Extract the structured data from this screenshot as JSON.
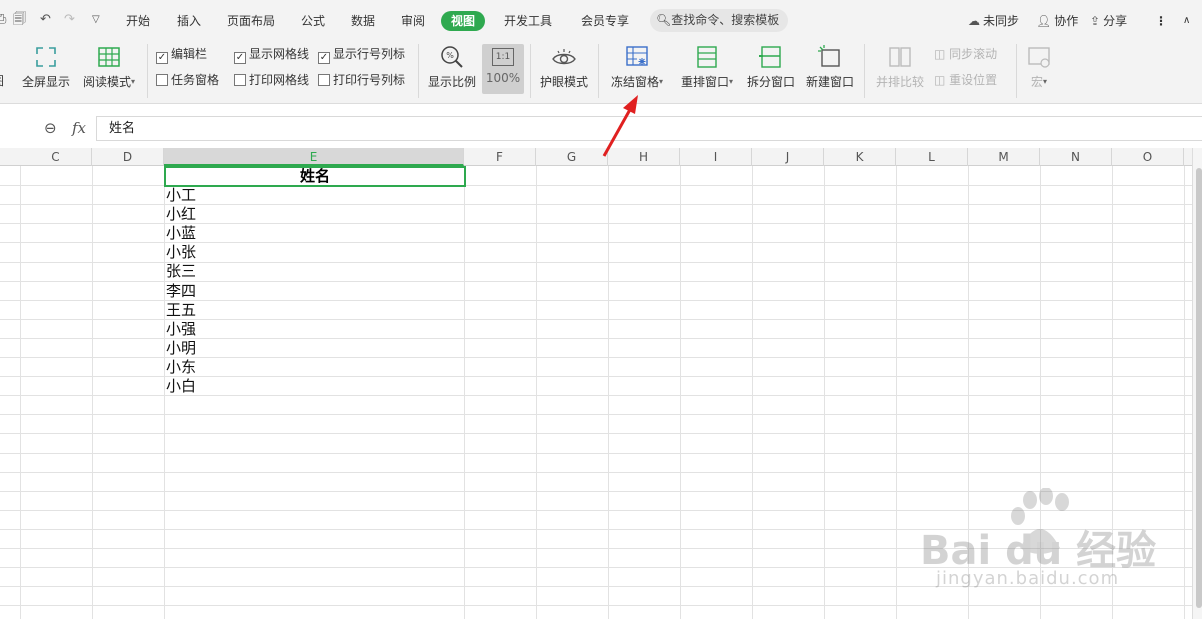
{
  "menu": {
    "start": "开始",
    "insert": "插入",
    "page_layout": "页面布局",
    "formula": "公式",
    "data": "数据",
    "review": "审阅",
    "view": "视图",
    "devtools": "开发工具",
    "member": "会员专享",
    "search_placeholder": "查找命令、搜索模板"
  },
  "top_right": {
    "not_synced": "未同步",
    "collaborate": "协作",
    "share": "分享"
  },
  "ribbon": {
    "partial_left": "图",
    "fullscreen": "全屏显示",
    "reading_mode": "阅读模式",
    "edit_bar": "编辑栏",
    "task_pane": "任务窗格",
    "show_gridlines": "显示网格线",
    "print_gridlines": "打印网格线",
    "show_headers": "显示行号列标",
    "print_headers": "打印行号列标",
    "zoom_ratio": "显示比例",
    "zoom_100": "100%",
    "zoom_1to1": "1:1",
    "eye_mode": "护眼模式",
    "freeze_panes": "冻结窗格",
    "arrange_windows": "重排窗口",
    "split_window": "拆分窗口",
    "new_window": "新建窗口",
    "side_by_side": "并排比较",
    "sync_scroll": "同步滚动",
    "reset_position": "重设位置",
    "macro": "宏"
  },
  "checkbox_state": {
    "edit_bar": true,
    "task_pane": false,
    "show_gridlines": true,
    "print_gridlines": false,
    "show_headers": true,
    "print_headers": false
  },
  "formula_bar": {
    "fx": "fx",
    "content": "姓名"
  },
  "columns": [
    "C",
    "D",
    "E",
    "F",
    "G",
    "H",
    "I",
    "J",
    "K",
    "L",
    "M",
    "N",
    "O"
  ],
  "selected_column": "E",
  "active_cell_value": "姓名",
  "cells": [
    "小工",
    "小红",
    "小蓝",
    "小张",
    "张三",
    "李四",
    "王五",
    "小强",
    "小明",
    "小东",
    "小白"
  ],
  "watermark": {
    "brand": "Bai du 经验",
    "url": "jingyan.baidu.com"
  },
  "colors": {
    "accent_green": "#2ea94f",
    "annotation_red": "#e02020"
  }
}
